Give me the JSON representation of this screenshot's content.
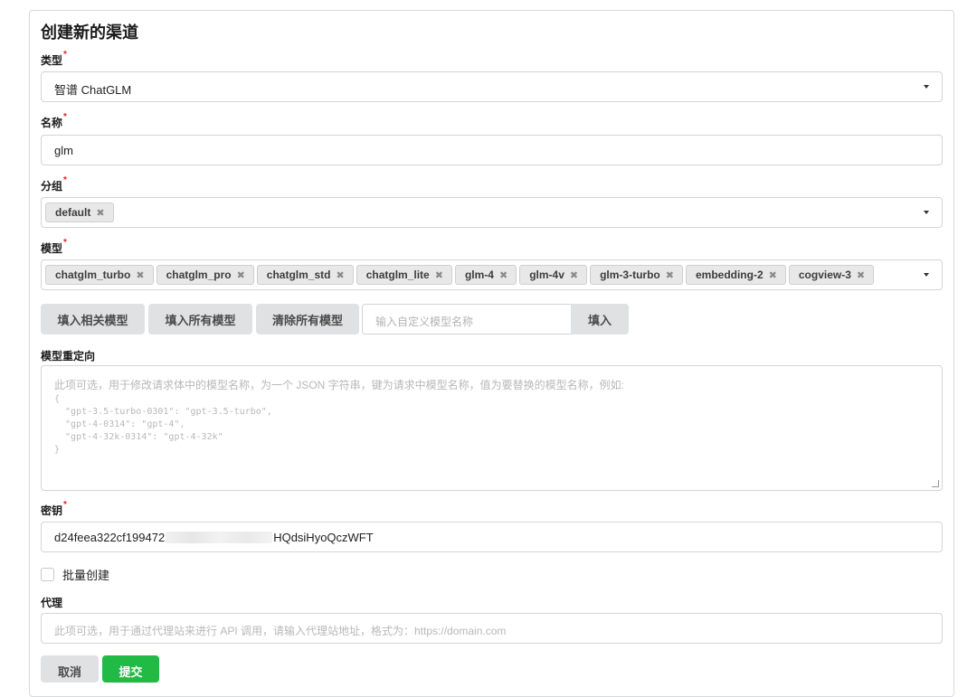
{
  "form": {
    "title": "创建新的渠道",
    "required_mark": "*"
  },
  "type": {
    "label": "类型",
    "value": "智谱 ChatGLM"
  },
  "name": {
    "label": "名称",
    "value": "glm"
  },
  "group": {
    "label": "分组",
    "chips": [
      "default"
    ]
  },
  "models": {
    "label": "模型",
    "chips": [
      "chatglm_turbo",
      "chatglm_pro",
      "chatglm_std",
      "chatglm_lite",
      "glm-4",
      "glm-4v",
      "glm-3-turbo",
      "embedding-2",
      "cogview-3"
    ]
  },
  "model_actions": {
    "fill_related": "填入相关模型",
    "fill_all": "填入所有模型",
    "clear_all": "清除所有模型",
    "custom_placeholder": "输入自定义模型名称",
    "fill": "填入"
  },
  "model_mapping": {
    "label": "模型重定向",
    "placeholder_line": "此项可选，用于修改请求体中的模型名称，为一个 JSON 字符串，键为请求中模型名称，值为要替换的模型名称，例如:",
    "placeholder_code": "{\n  \"gpt-3.5-turbo-0301\": \"gpt-3.5-turbo\",\n  \"gpt-4-0314\": \"gpt-4\",\n  \"gpt-4-32k-0314\": \"gpt-4-32k\"\n}"
  },
  "key": {
    "label": "密钥",
    "value_prefix": "d24feea322cf199472",
    "value_suffix": "HQdsiHyoQczWFT"
  },
  "batch": {
    "label": "批量创建",
    "checked": false
  },
  "proxy": {
    "label": "代理",
    "placeholder": "此项可选，用于通过代理站来进行 API 调用，请输入代理站地址，格式为：https://domain.com"
  },
  "footer": {
    "cancel": "取消",
    "submit": "提交"
  },
  "colors": {
    "required": "#db2828",
    "submit": "#21ba45",
    "button_gray": "#e0e1e2"
  }
}
